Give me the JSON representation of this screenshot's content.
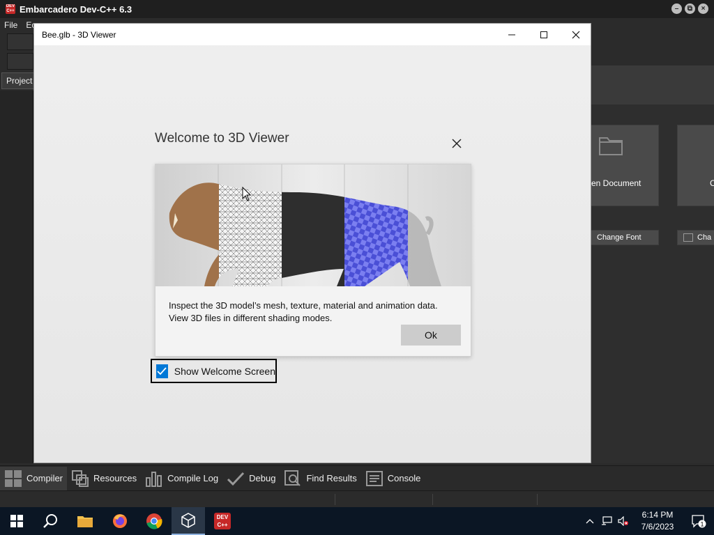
{
  "devcpp": {
    "title": "Embarcadero Dev-C++ 6.3",
    "logo_text": "DEV C++",
    "menu": [
      "File",
      "Ec"
    ],
    "project_tab": "Project",
    "open_document_label": "en Document",
    "second_card_label": "C",
    "change_font_label": "Change Font",
    "cha_label": "Cha",
    "bottom_tabs": [
      {
        "label": "Compiler",
        "icon": "compiler-icon"
      },
      {
        "label": "Resources",
        "icon": "resources-icon"
      },
      {
        "label": "Compile Log",
        "icon": "compile-log-icon"
      },
      {
        "label": "Debug",
        "icon": "debug-check-icon"
      },
      {
        "label": "Find Results",
        "icon": "find-results-icon"
      },
      {
        "label": "Console",
        "icon": "console-icon"
      }
    ]
  },
  "viewer": {
    "title": "Bee.glb - 3D Viewer",
    "welcome": {
      "title": "Welcome to 3D Viewer",
      "desc_line1": "Inspect the 3D model’s mesh, texture, material and animation data.",
      "desc_line2": "View 3D files in different shading modes.",
      "ok_label": "Ok",
      "show_welcome_label": "Show Welcome Screen",
      "show_welcome_checked": true,
      "hero_image": "saber-tooth-cat-shading-modes"
    }
  },
  "taskbar": {
    "items": [
      "start-icon",
      "search-icon",
      "file-explorer-icon",
      "firefox-icon",
      "chrome-icon",
      "3d-viewer-icon",
      "devcpp-icon"
    ],
    "devcpp_icon_text": "DEV C++",
    "time": "6:14 PM",
    "date": "7/6/2023",
    "notification_count": "1"
  },
  "colors": {
    "accent": "#0078d7",
    "taskbar": "#0b1624",
    "devcpp_dark": "#2b2b2b"
  }
}
